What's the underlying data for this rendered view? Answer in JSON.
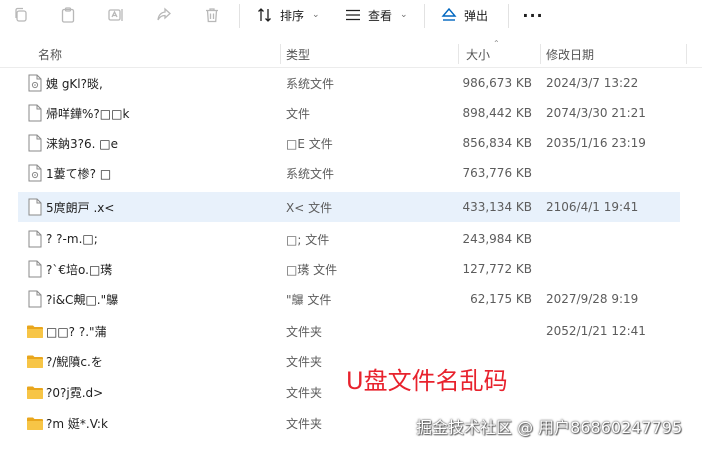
{
  "toolbar": {
    "sort_label": "排序",
    "view_label": "查看",
    "eject_label": "弹出",
    "more_label": "···"
  },
  "columns": {
    "name": "名称",
    "type": "类型",
    "size": "大小",
    "date": "修改日期"
  },
  "rows": [
    {
      "icon": "system-file-icon",
      "name": "媿  gKl?晱,",
      "type": "系统文件",
      "size": "986,673 KB",
      "date": "2024/3/7 13:22"
    },
    {
      "icon": "file-icon",
      "name": "帰咩鏵%?□□k",
      "type": "文件",
      "size": "898,442 KB",
      "date": "2074/3/30 21:21"
    },
    {
      "icon": "file-icon",
      "name": "涞鈉3?6. □e",
      "type": "□E 文件",
      "size": "856,834 KB",
      "date": "2035/1/16 23:19"
    },
    {
      "icon": "system-file-icon",
      "name": "1蔞て椮?  □",
      "type": "系统文件",
      "size": "763,776 KB",
      "date": ""
    },
    {
      "icon": "file-icon",
      "name": "5庹朗戸 .x<",
      "type": "X< 文件",
      "size": "433,134 KB",
      "date": "2106/4/1 19:41",
      "selected": true
    },
    {
      "icon": "file-icon",
      "name": "?  ?-m.□;",
      "type": "□; 文件",
      "size": "243,984 KB",
      "date": ""
    },
    {
      "icon": "file-icon",
      "name": " ?`€培o.□璓",
      "type": "□璓 文件",
      "size": "127,772 KB",
      "date": ""
    },
    {
      "icon": "file-icon",
      "name": "?i&C覥□.\"鸔",
      "type": "\"鸔 文件",
      "size": "62,175 KB",
      "date": "2027/9/28 9:19"
    },
    {
      "icon": "folder-icon",
      "name": "□□?  ?.\"蒲",
      "type": "文件夹",
      "size": "",
      "date": "2052/1/21 12:41"
    },
    {
      "icon": "folder-icon",
      "name": "?/鯢隫c.を",
      "type": "文件夹",
      "size": "",
      "date": ""
    },
    {
      "icon": "folder-icon",
      "name": "?0?j霓.d>",
      "type": "文件夹",
      "size": "",
      "date": ""
    },
    {
      "icon": "folder-icon",
      "name": "?m  娗*.V:k",
      "type": "文件夹",
      "size": "",
      "date": ""
    }
  ],
  "overlay": {
    "title": "U盘文件名乱码",
    "watermark": "掘金技术社区 @ 用户86860247795"
  },
  "colors": {
    "accent": "#0067c0",
    "selected_row": "#e8f1fb",
    "folder": "#f7c546",
    "overlay_red": "#e8222d"
  }
}
